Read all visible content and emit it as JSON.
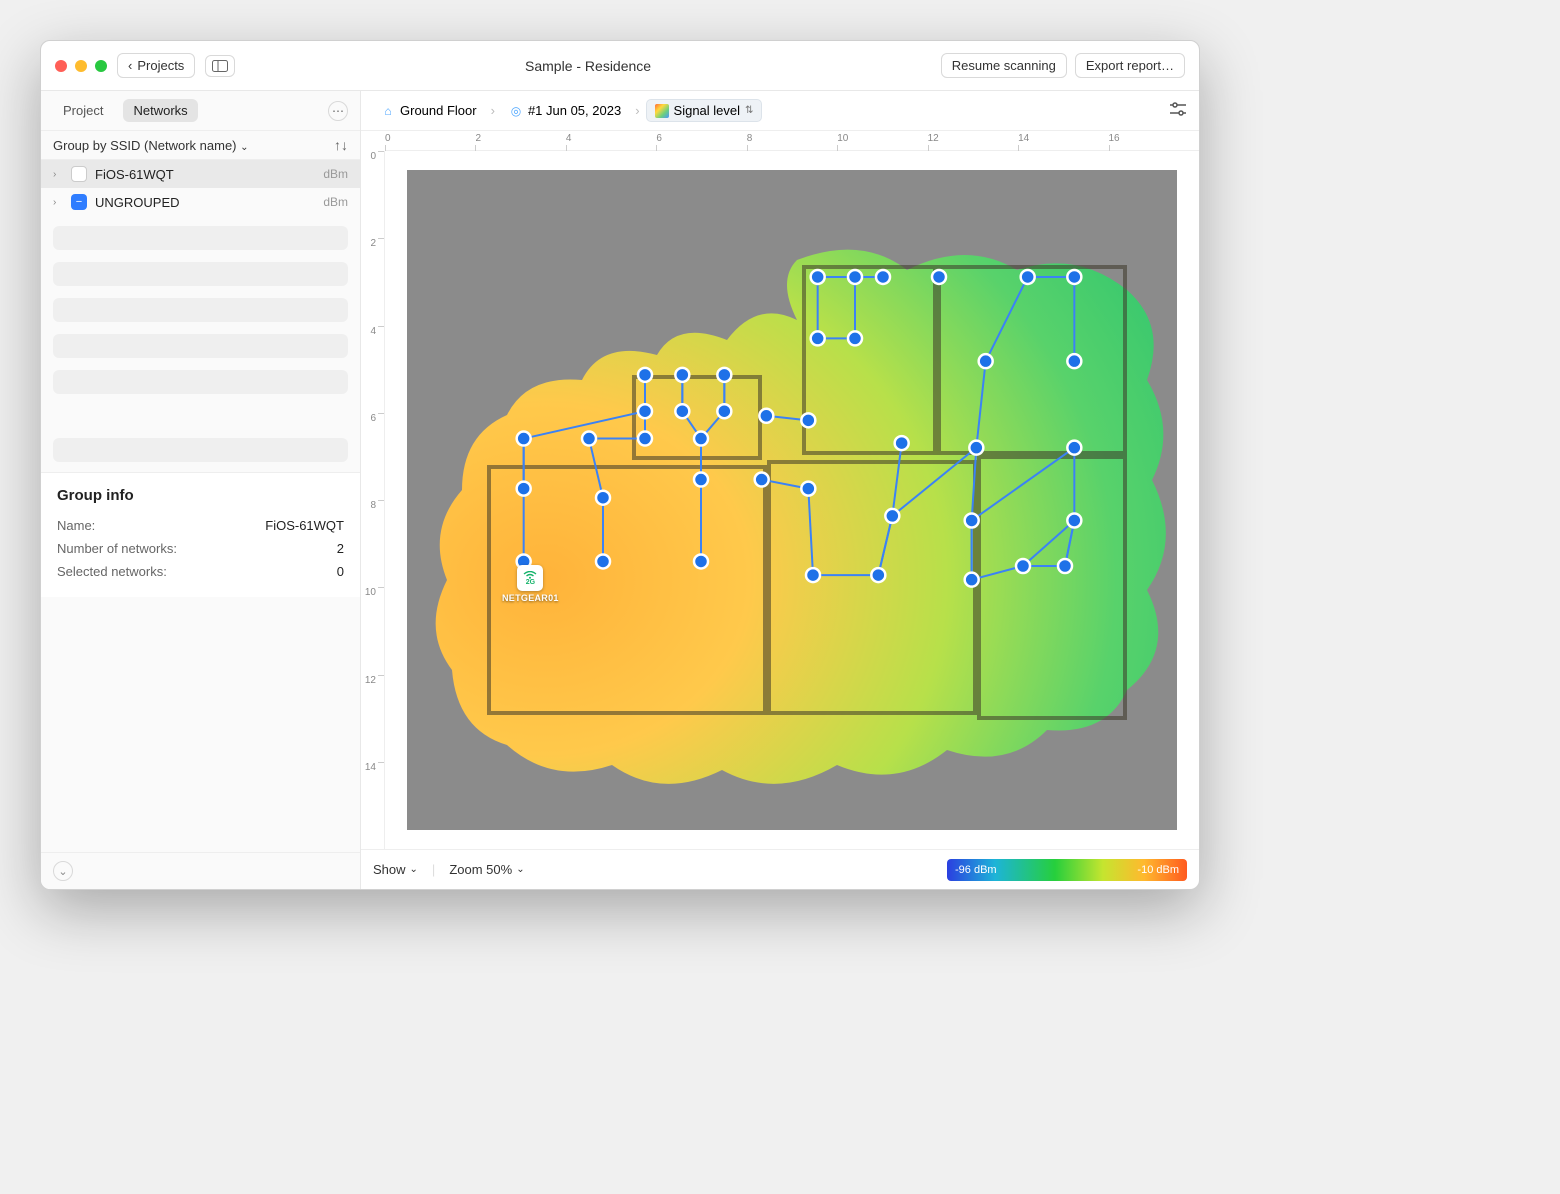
{
  "titlebar": {
    "back_label": "Projects",
    "title": "Sample - Residence",
    "resume_btn": "Resume scanning",
    "export_btn": "Export report…"
  },
  "sidebar": {
    "tabs": {
      "project": "Project",
      "networks": "Networks"
    },
    "group_by_label": "Group by SSID (Network name)",
    "items": [
      {
        "name": "FiOS-61WQT",
        "unit": "dBm",
        "color": "white",
        "selected": true
      },
      {
        "name": "UNGROUPED",
        "unit": "dBm",
        "color": "blue",
        "selected": false
      }
    ],
    "group_info": {
      "heading": "Group info",
      "rows": [
        {
          "label": "Name:",
          "value": "FiOS-61WQT"
        },
        {
          "label": "Number of networks:",
          "value": "2"
        },
        {
          "label": "Selected networks:",
          "value": "0"
        }
      ]
    }
  },
  "breadcrumb": {
    "floor": "Ground Floor",
    "survey": "#1 Jun 05, 2023",
    "visualization": "Signal level"
  },
  "rulers": {
    "h": [
      "0",
      "2",
      "4",
      "6",
      "8",
      "10",
      "12",
      "14",
      "16"
    ],
    "v": [
      "0",
      "2",
      "4",
      "6",
      "8",
      "10",
      "12",
      "14"
    ]
  },
  "ap_marker": {
    "band": "2G",
    "name": "NETGEAR01"
  },
  "bottombar": {
    "show_label": "Show",
    "zoom_label": "Zoom 50%",
    "legend_min": "-96 dBm",
    "legend_max": "-10 dBm"
  },
  "chart_data": {
    "type": "heatmap",
    "title": "Signal level",
    "unit": "dBm",
    "color_scale": {
      "min": -96,
      "max": -10,
      "stops": [
        "#2b3fe0",
        "#1db4d8",
        "#26cf3c",
        "#c5e52f",
        "#ffb92e",
        "#ff5a1f"
      ]
    },
    "access_points": [
      {
        "name": "NETGEAR01",
        "band": "2G",
        "x": 2.3,
        "y": 8.6
      }
    ],
    "survey_path_nodes": [
      [
        8.8,
        2.35
      ],
      [
        9.6,
        2.35
      ],
      [
        10.2,
        2.35
      ],
      [
        11.4,
        2.35
      ],
      [
        13.3,
        2.35
      ],
      [
        14.3,
        2.35
      ],
      [
        8.8,
        3.7
      ],
      [
        9.6,
        3.7
      ],
      [
        12.4,
        4.2
      ],
      [
        14.3,
        4.2
      ],
      [
        5.1,
        4.5
      ],
      [
        5.9,
        4.5
      ],
      [
        6.8,
        4.5
      ],
      [
        5.1,
        5.3
      ],
      [
        5.9,
        5.3
      ],
      [
        6.8,
        5.3
      ],
      [
        7.7,
        5.4
      ],
      [
        8.6,
        5.5
      ],
      [
        2.5,
        5.9
      ],
      [
        3.9,
        5.9
      ],
      [
        5.1,
        5.9
      ],
      [
        6.3,
        5.9
      ],
      [
        10.6,
        6.0
      ],
      [
        12.2,
        6.1
      ],
      [
        14.3,
        6.1
      ],
      [
        2.5,
        7.0
      ],
      [
        4.2,
        7.2
      ],
      [
        6.3,
        6.8
      ],
      [
        7.6,
        6.8
      ],
      [
        8.6,
        7.0
      ],
      [
        10.4,
        7.6
      ],
      [
        12.1,
        7.7
      ],
      [
        14.3,
        7.7
      ],
      [
        2.5,
        8.6
      ],
      [
        4.2,
        8.6
      ],
      [
        6.3,
        8.6
      ],
      [
        8.7,
        8.9
      ],
      [
        10.1,
        8.9
      ],
      [
        12.1,
        9.0
      ],
      [
        13.2,
        8.7
      ],
      [
        14.1,
        8.7
      ]
    ]
  }
}
